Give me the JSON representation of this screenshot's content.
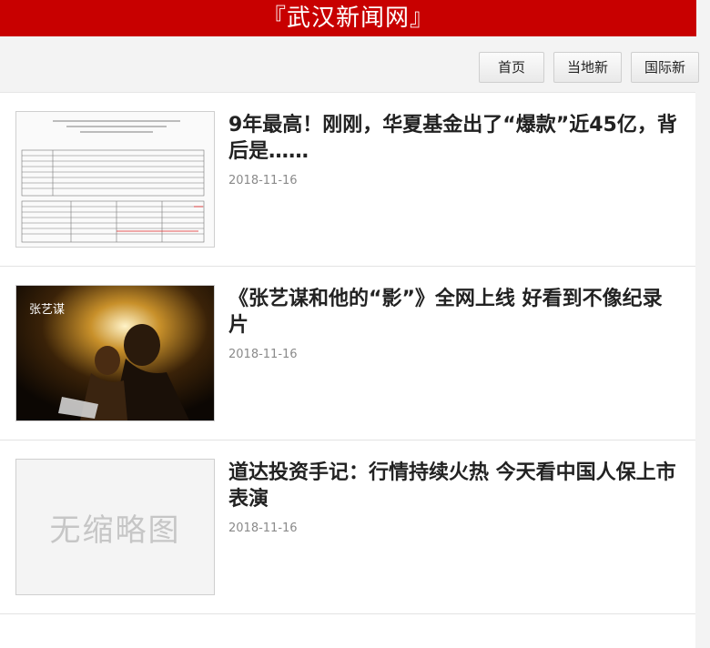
{
  "header": {
    "title": "『武汉新闻网』",
    "bg_color": "#c80000"
  },
  "nav": {
    "items": [
      "首页",
      "当地新",
      "国际新"
    ]
  },
  "articles": [
    {
      "title": "9年最高！刚刚，华夏基金出了“爆款”近45亿，背后是……",
      "date": "2018-11-16",
      "thumb": "document-scan"
    },
    {
      "title": "《张艺谋和他的“影”》全网上线 好看到不像纪录片",
      "date": "2018-11-16",
      "thumb": "night-photo"
    },
    {
      "title": "道达投资手记：行情持续火热 今天看中国人保上市表演",
      "date": "2018-11-16",
      "thumb": "placeholder",
      "thumb_text": "无缩略图"
    }
  ]
}
